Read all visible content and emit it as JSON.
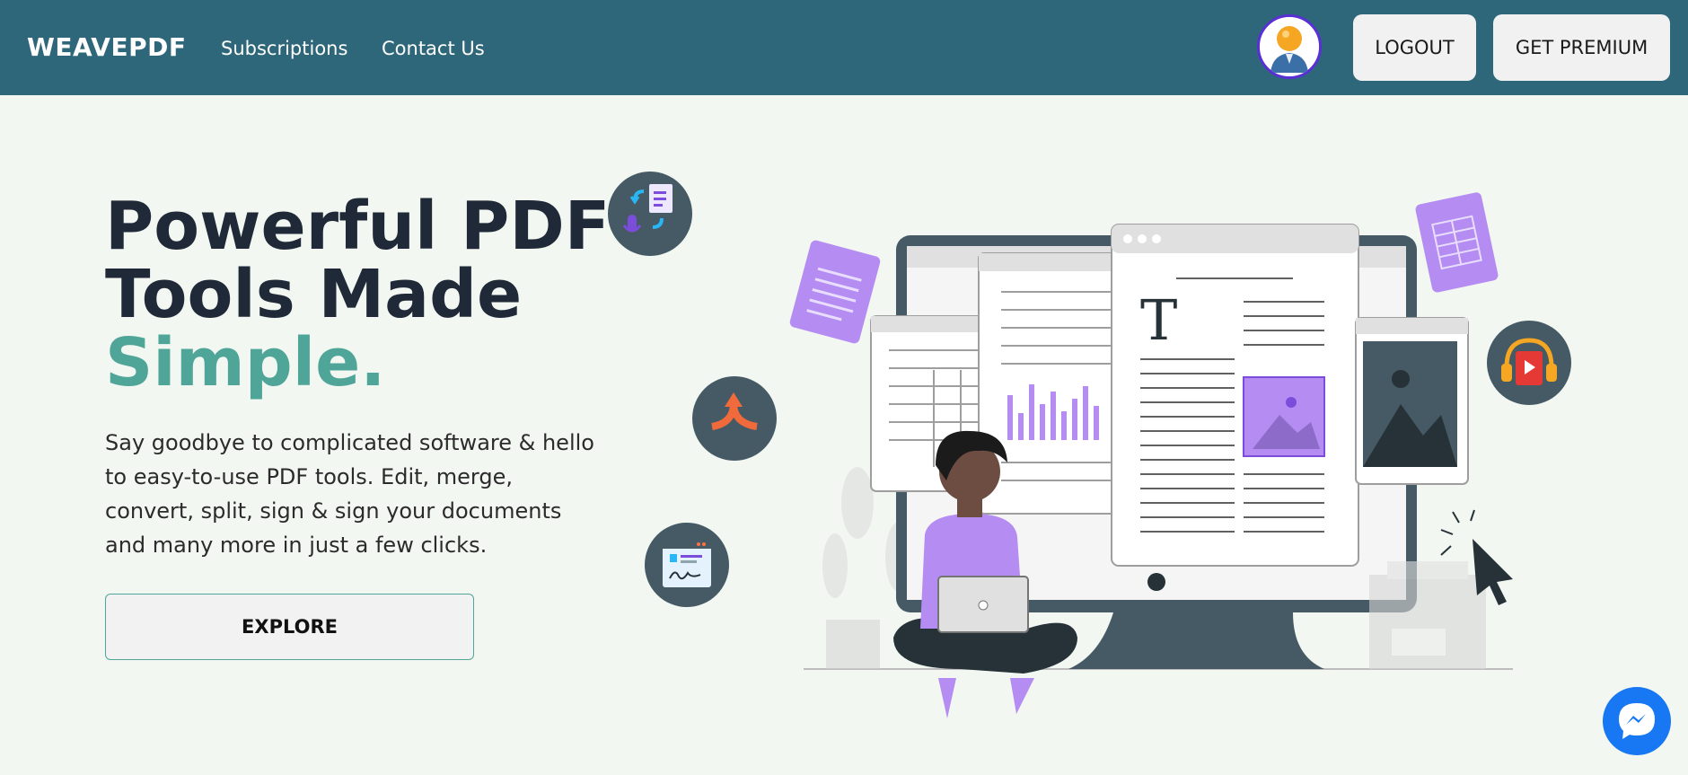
{
  "header": {
    "brand": "WEAVEPDF",
    "links": [
      "Subscriptions",
      "Contact Us"
    ],
    "logout_label": "LOGOUT",
    "premium_label": "GET PREMIUM"
  },
  "hero": {
    "title_line1": "Powerful PDF",
    "title_line2": "Tools Made",
    "title_accent": "Simple.",
    "description": "Say goodbye to complicated software & hello to easy-to-use PDF tools. Edit, merge, convert, split, sign & sign your documents and many more in just a few clicks.",
    "explore_label": "EXPLORE",
    "illustration_text": "T"
  },
  "colors": {
    "nav_bg": "#2e6779",
    "page_bg": "#f3f7f2",
    "accent": "#4fa598",
    "purple": "#b48cf2",
    "dark": "#455a64",
    "messenger": "#1877f2"
  },
  "icons": [
    "user-avatar-icon",
    "convert-document-icon",
    "merge-arrows-icon",
    "sign-document-icon",
    "audio-book-icon",
    "messenger-icon"
  ]
}
